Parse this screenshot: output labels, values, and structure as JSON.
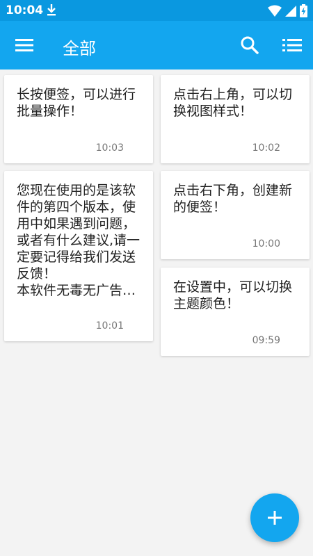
{
  "status_bar": {
    "time": "10:04",
    "icons": [
      "download-icon",
      "wifi-icon",
      "signal-icon",
      "battery-charging-icon"
    ]
  },
  "app_bar": {
    "title": "全部",
    "left_icon": "menu-icon",
    "right_icons": [
      "search-icon",
      "list-view-icon"
    ]
  },
  "colors": {
    "primary": "#13a6ef",
    "status_bar": "#0a98e0",
    "background": "#f3f3f3",
    "card": "#ffffff"
  },
  "notes": [
    {
      "text": "长按便签，可以进行批量操作！",
      "time": "10:03"
    },
    {
      "text": "点击右上角，可以切换视图样式！",
      "time": "10:02"
    },
    {
      "text": "您现在使用的是该软件的第四个版本，使用中如果遇到问题，或者有什么建议,请一定要记得给我们发送反馈！\n本软件无毒无广告…",
      "time": "10:01"
    },
    {
      "text": "点击右下角，创建新的便签！",
      "time": "10:00"
    },
    {
      "text": "在设置中，可以切换主题颜色！",
      "time": "09:59"
    }
  ],
  "fab": {
    "icon": "plus-icon"
  }
}
